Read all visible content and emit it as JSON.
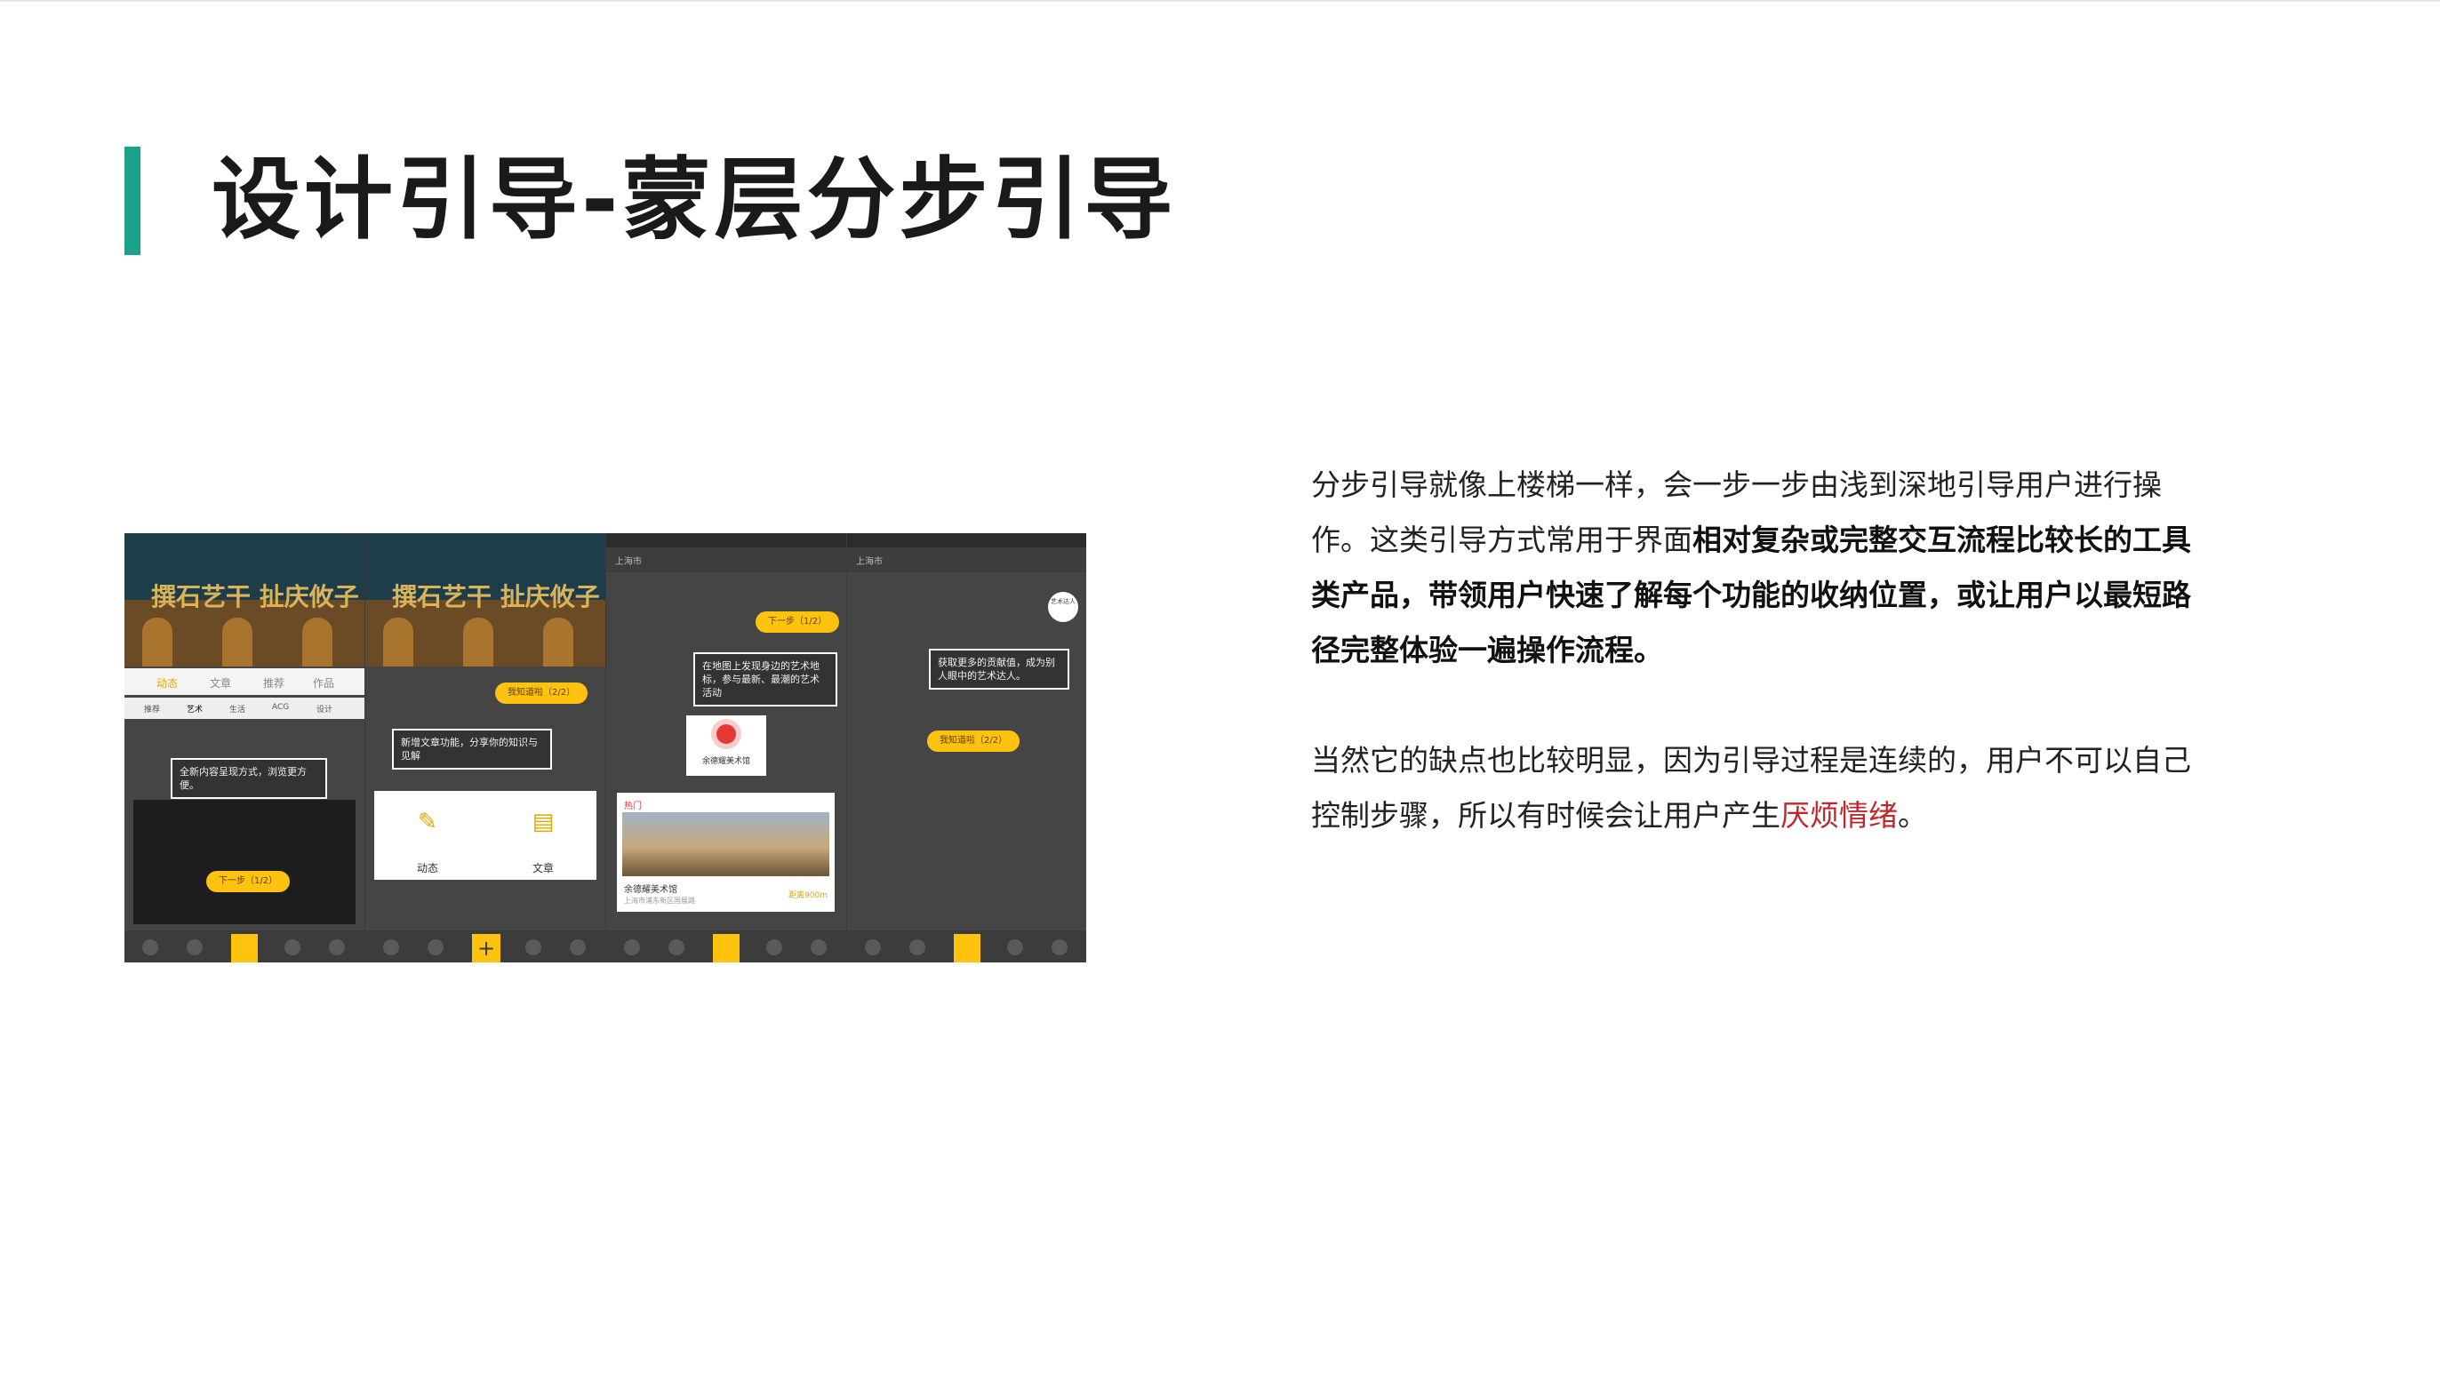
{
  "slide": {
    "title": "设计引导-蒙层分步引导",
    "accent_color": "#1aa38a"
  },
  "paragraph1": {
    "part1": "分步引导就像上楼梯一样，会一步一步由浅到深地引导用户进行操作。这类引导方式常用于界面",
    "bold": "相对复杂或完整交互流程比较长的工具类产品，带领用户快速了解每个功能的收纳位置，或让用户以最短路径完整体验一遍操作流程。"
  },
  "paragraph2": {
    "part1": "当然它的缺点也比较明显，因为引导过程是连续的，用户不可以自己控制步骤，所以有时候会让用户产生",
    "highlight": "厌烦情绪",
    "highlight_color": "#c0272d",
    "end": "。"
  },
  "screenshots": {
    "phone1": {
      "poster_text": "撰石艺干 扯庆攸子",
      "tabs": [
        "动态",
        "文章",
        "推荐",
        "作品"
      ],
      "subtabs": [
        "推荐",
        "艺术",
        "生活",
        "ACG",
        "设计"
      ],
      "tip": "全新内容呈现方式，浏览更方便。",
      "button": "下一步（1/2）"
    },
    "phone2": {
      "poster_text": "撰石艺干 扯庆攸子",
      "tip": "新增文章功能，分享你的知识与见解",
      "button": "我知道啦（2/2）",
      "option1": "动态",
      "option2": "文章",
      "plus": "+"
    },
    "phone3": {
      "location": "上海市",
      "button": "下一步（1/2）",
      "tip": "在地图上发现身边的艺术地标，参与最新、最潮的艺术活动",
      "pin_label": "余德耀美术馆",
      "hot_tag": "热门",
      "venue_name": "余德耀美术馆",
      "venue_address": "上海市浦东新区国展路",
      "venue_distance": "距离900m"
    },
    "phone4": {
      "location": "上海市",
      "corner_button": "艺术达人",
      "tip": "获取更多的贡献值，成为别人眼中的艺术达人。",
      "button": "我知道啦（2/2）"
    }
  }
}
